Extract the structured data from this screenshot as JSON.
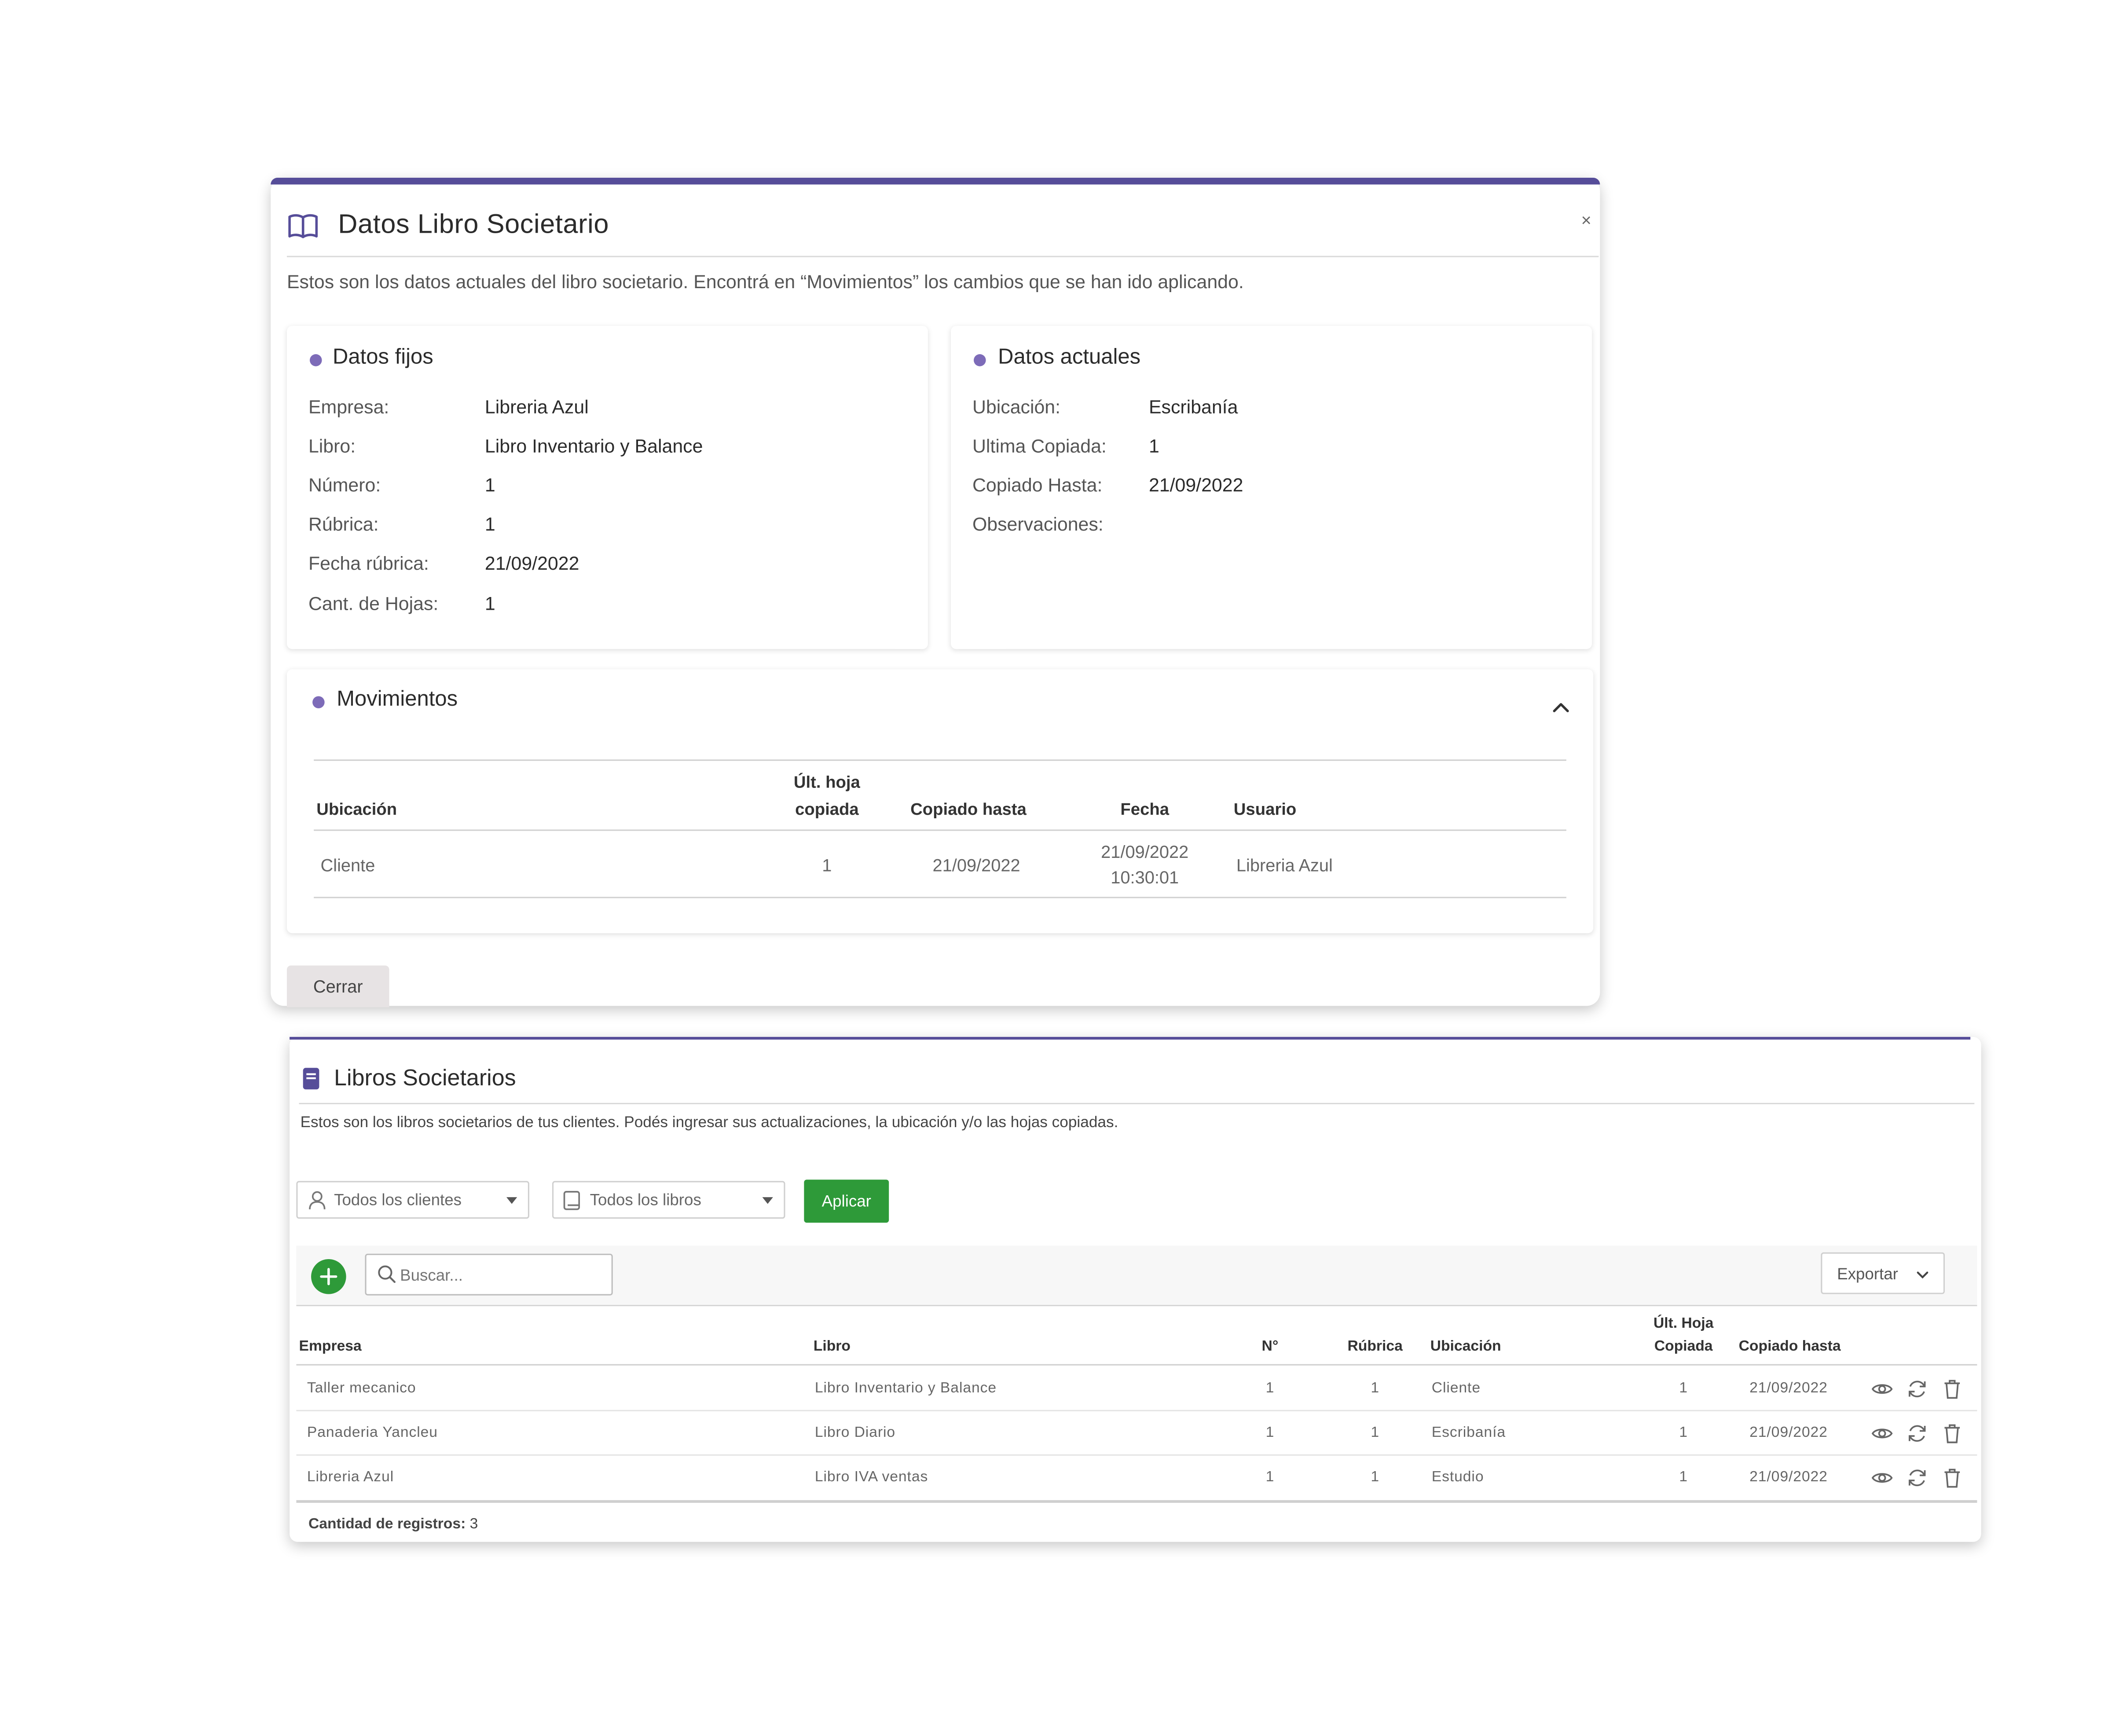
{
  "modal": {
    "title": "Datos Libro Societario",
    "close_label": "×",
    "description": "Estos son los datos actuales del libro societario. Encontrá en “Movimientos” los cambios que se han ido aplicando.",
    "datos_fijos": {
      "title": "Datos fijos",
      "fields": [
        {
          "label": "Empresa:",
          "value": "Libreria Azul"
        },
        {
          "label": "Libro:",
          "value": "Libro Inventario y Balance"
        },
        {
          "label": "Número:",
          "value": "1"
        },
        {
          "label": "Rúbrica:",
          "value": "1"
        },
        {
          "label": "Fecha rúbrica:",
          "value": "21/09/2022"
        },
        {
          "label": "Cant. de Hojas:",
          "value": "1"
        }
      ]
    },
    "datos_actuales": {
      "title": "Datos actuales",
      "fields": [
        {
          "label": "Ubicación:",
          "value": "Escribanía"
        },
        {
          "label": "Ultima Copiada:",
          "value": "1"
        },
        {
          "label": "Copiado Hasta:",
          "value": "21/09/2022"
        },
        {
          "label": "Observaciones:",
          "value": ""
        }
      ]
    },
    "movimientos": {
      "title": "Movimientos",
      "columns": {
        "ubicacion": "Ubicación",
        "ult_hoja_1": "Últ. hoja",
        "ult_hoja_2": "copiada",
        "copiado_hasta": "Copiado hasta",
        "fecha": "Fecha",
        "usuario": "Usuario"
      },
      "rows": [
        {
          "ubicacion": "Cliente",
          "ult_hoja": "1",
          "copiado_hasta": "21/09/2022",
          "fecha_1": "21/09/2022",
          "fecha_2": "10:30:01",
          "usuario": "Libreria Azul"
        }
      ]
    },
    "close_button": "Cerrar"
  },
  "list": {
    "title": "Libros Societarios",
    "description": "Estos son los libros societarios de tus clientes. Podés ingresar sus actualizaciones, la ubicación y/o las hojas copiadas.",
    "filter_clients": "Todos los clientes",
    "filter_books": "Todos los libros",
    "apply_button": "Aplicar",
    "search_placeholder": "Buscar...",
    "export_button": "Exportar",
    "columns": {
      "empresa": "Empresa",
      "libro": "Libro",
      "numero": "N°",
      "rubrica": "Rúbrica",
      "ubicacion": "Ubicación",
      "ult_hoja_1": "Últ. Hoja",
      "ult_hoja_2": "Copiada",
      "copiado_hasta": "Copiado hasta"
    },
    "rows": [
      {
        "empresa": "Taller mecanico",
        "libro": "Libro Inventario y Balance",
        "numero": "1",
        "rubrica": "1",
        "ubicacion": "Cliente",
        "ult_hoja": "1",
        "copiado_hasta": "21/09/2022"
      },
      {
        "empresa": "Panaderia Yancleu",
        "libro": "Libro Diario",
        "numero": "1",
        "rubrica": "1",
        "ubicacion": "Escribanía",
        "ult_hoja": "1",
        "copiado_hasta": "21/09/2022"
      },
      {
        "empresa": "Libreria Azul",
        "libro": "Libro IVA ventas",
        "numero": "1",
        "rubrica": "1",
        "ubicacion": "Estudio",
        "ult_hoja": "1",
        "copiado_hasta": "21/09/2022"
      }
    ],
    "record_count_label": "Cantidad de registros:",
    "record_count": "3"
  },
  "colors": {
    "accent": "#564d99",
    "bullet": "#7d6bb8",
    "success": "#2e9a39"
  },
  "icons": [
    "open-book-icon",
    "close-icon",
    "chevron-up-icon",
    "book-icon",
    "user-icon",
    "caret-down-icon",
    "plus-icon",
    "search-icon",
    "chevron-down-icon",
    "eye-icon",
    "refresh-icon",
    "trash-icon"
  ]
}
